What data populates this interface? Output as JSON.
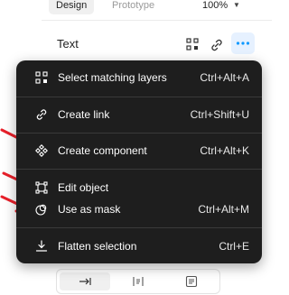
{
  "tabs": {
    "design": "Design",
    "prototype": "Prototype"
  },
  "zoom": "100%",
  "section": {
    "label": "Text"
  },
  "menu": {
    "items": [
      {
        "label": "Select matching layers",
        "shortcut": "Ctrl+Alt+A",
        "icon": "select-matching-icon"
      },
      {
        "label": "Create link",
        "shortcut": "Ctrl+Shift+U",
        "icon": "link-icon"
      },
      {
        "label": "Create component",
        "shortcut": "Ctrl+Alt+K",
        "icon": "component-icon"
      },
      {
        "label": "Edit object",
        "shortcut": "",
        "icon": "edit-object-icon"
      },
      {
        "label": "Use as mask",
        "shortcut": "Ctrl+Alt+M",
        "icon": "mask-icon"
      },
      {
        "label": "Flatten selection",
        "shortcut": "Ctrl+E",
        "icon": "flatten-icon"
      }
    ]
  },
  "colors": {
    "menu_bg": "#1e1e1e",
    "accent": "#0d99ff",
    "annotation": "#e8202a"
  }
}
